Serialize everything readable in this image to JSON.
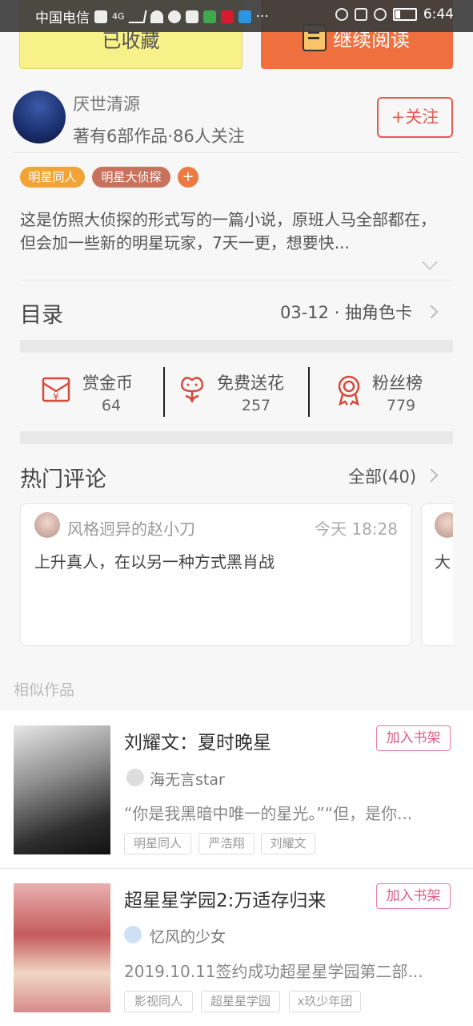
{
  "status_bar": {
    "carrier": "中国电信",
    "network": "4G",
    "time": "6:44"
  },
  "actions": {
    "collected_label": "已收藏",
    "continue_label": "继续阅读"
  },
  "author": {
    "name": "厌世清源",
    "stats": "著有6部作品·86人关注",
    "follow_label": "+关注"
  },
  "tags": [
    {
      "label": "明星同人",
      "color": "#f1a336"
    },
    {
      "label": "明星大侦探",
      "color": "#c8725e"
    },
    {
      "label": "+",
      "color": "#ee7a42"
    }
  ],
  "description": "这是仿照大侦探的形式写的一篇小说，原班人马全部都在，但会加一些新的明星玩家，7天一更，想要快...",
  "toc": {
    "title": "目录",
    "latest": "03-12 · 抽角色卡"
  },
  "stats": [
    {
      "label": "赏金币",
      "value": "64",
      "icon": "money-envelope-icon"
    },
    {
      "label": "免费送花",
      "value": "257",
      "icon": "flower-icon"
    },
    {
      "label": "粉丝榜",
      "value": "779",
      "icon": "medal-icon"
    }
  ],
  "comments": {
    "title": "热门评论",
    "all_label": "全部(40)",
    "items": [
      {
        "user": "风格迥异的赵小刀",
        "time": "今天 18:28",
        "text": "上升真人，在以另一种方式黑肖战"
      },
      {
        "user": "",
        "time": "",
        "text": "大"
      }
    ]
  },
  "similar": {
    "label": "相似作品",
    "add_label": "加入书架",
    "books": [
      {
        "title": "刘耀文：夏时晚星",
        "author": "海无言star",
        "desc": "“你是我黑暗中唯一的星光。”“但，是你...",
        "tags": [
          "明星同人",
          "严浩翔",
          "刘耀文"
        ]
      },
      {
        "title": "超星星学园2:万适存归来",
        "author": "忆风的少女",
        "desc": "2019.10.11签约成功超星星学园第二部...",
        "tags": [
          "影视同人",
          "超星星学园",
          "x玖少年团"
        ]
      }
    ]
  },
  "colors": {
    "accent": "#ef6f3e",
    "follow": "#e25b50",
    "collected_bg": "#f8f089",
    "add_shelf": "#e05c85"
  }
}
